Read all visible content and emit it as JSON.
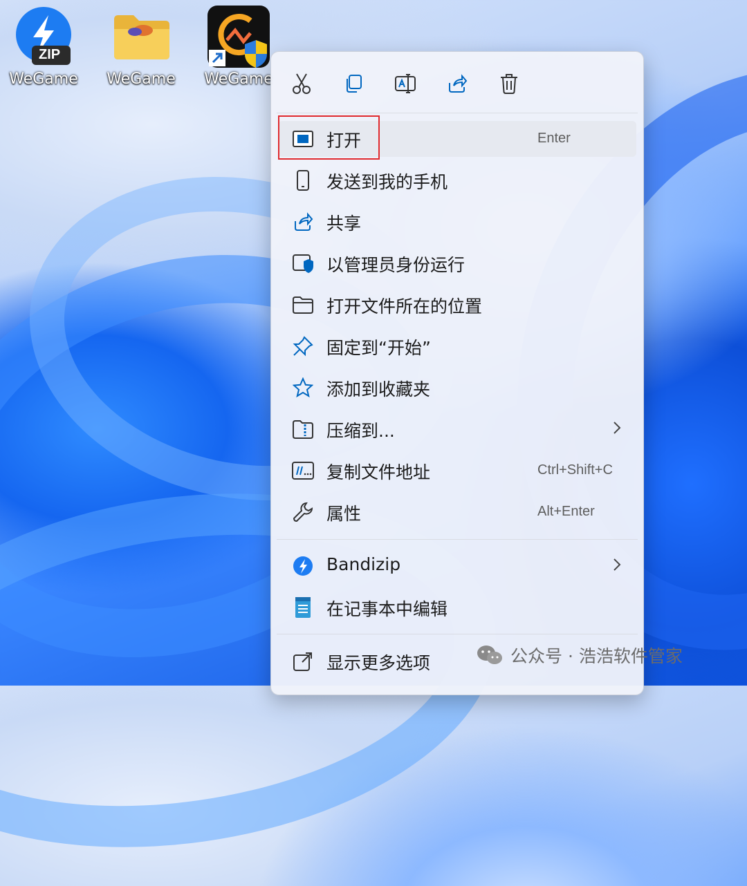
{
  "desktop": {
    "icons": [
      {
        "label": "WeGame",
        "badge": "ZIP",
        "icon": "bandizip-archive-icon"
      },
      {
        "label": "WeGame",
        "icon": "folder-icon"
      },
      {
        "label": "WeGame",
        "icon": "wegame-shortcut-icon"
      }
    ]
  },
  "context_menu": {
    "toolbar": [
      {
        "name": "cut",
        "icon": "scissors-icon"
      },
      {
        "name": "copy",
        "icon": "copy-icon"
      },
      {
        "name": "rename",
        "icon": "rename-icon"
      },
      {
        "name": "share",
        "icon": "share-icon"
      },
      {
        "name": "delete",
        "icon": "trash-icon"
      }
    ],
    "items": [
      {
        "label": "打开",
        "shortcut": "Enter",
        "icon": "app-window-icon"
      },
      {
        "label": "发送到我的手机",
        "icon": "phone-icon"
      },
      {
        "label": "共享",
        "icon": "share-icon"
      },
      {
        "label": "以管理员身份运行",
        "icon": "admin-shield-icon"
      },
      {
        "label": "打开文件所在的位置",
        "icon": "folder-open-icon"
      },
      {
        "label": "固定到“开始”",
        "icon": "pin-icon"
      },
      {
        "label": "添加到收藏夹",
        "icon": "star-icon"
      },
      {
        "label": "压缩到...",
        "icon": "zip-folder-icon",
        "submenu": true
      },
      {
        "label": "复制文件地址",
        "shortcut": "Ctrl+Shift+C",
        "icon": "copy-path-icon"
      },
      {
        "label": "属性",
        "shortcut": "Alt+Enter",
        "icon": "wrench-icon"
      }
    ],
    "extra_items": [
      {
        "label": "Bandizip",
        "icon": "bandizip-icon",
        "submenu": true
      },
      {
        "label": "在记事本中编辑",
        "icon": "notepad-icon"
      }
    ],
    "more": {
      "label": "显示更多选项",
      "icon": "show-more-icon"
    }
  },
  "watermark": {
    "text": "公众号 · 浩浩软件管家"
  },
  "colors": {
    "accent": "#0067c0",
    "highlight_box": "#e0292d",
    "menu_bg": "#f0f3fa"
  }
}
